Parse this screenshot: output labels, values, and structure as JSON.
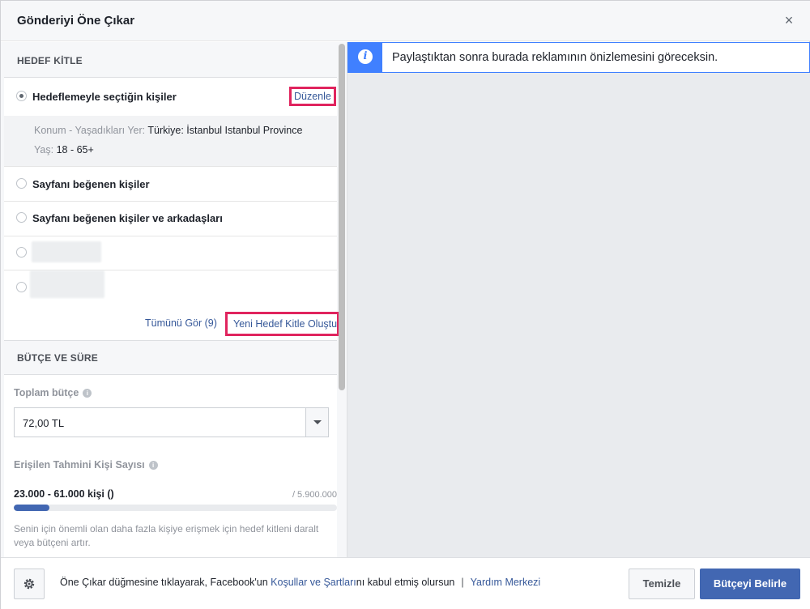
{
  "dialog": {
    "title": "Gönderiyi Öne Çıkar",
    "close_icon": "close-icon"
  },
  "audience": {
    "section_title": "HEDEF KİTLE",
    "options": [
      {
        "label": "Hedeflemeyle seçtiğin kişiler",
        "selected": true
      },
      {
        "label": "Sayfanı beğenen kişiler",
        "selected": false
      },
      {
        "label": "Sayfanı beğenen kişiler ve arkadaşları",
        "selected": false
      },
      {
        "label": "",
        "selected": false
      },
      {
        "label": "",
        "selected": false
      }
    ],
    "edit_label": "Düzenle",
    "details": {
      "location_key": "Konum - Yaşadıkları Yer:",
      "location_value": "Türkiye: İstanbul Istanbul Province",
      "age_key": "Yaş:",
      "age_value": "18 - 65+"
    },
    "see_all_label": "Tümünü Gör (9)",
    "new_audience_label": "Yeni Hedef Kitle Oluştur"
  },
  "budget": {
    "section_title": "BÜTÇE VE SÜRE",
    "total_label": "Toplam bütçe",
    "total_value": "72,00 TL",
    "reach_label": "Erişilen Tahmini Kişi Sayısı",
    "reach_range": "23.000 - 61.000 kişi ()",
    "reach_total": "/ 5.900.000",
    "reach_fraction": 0.11,
    "hint": "Senin için önemli olan daha fazla kişiye erişmek için hedef kitleni daralt veya bütçeni artır."
  },
  "preview": {
    "notice": "Paylaştıktan sonra burada reklamının önizlemesini göreceksin.",
    "icon": "info-icon"
  },
  "footer": {
    "text_before": "Öne Çıkar düğmesine tıklayarak, Facebook'un ",
    "terms_link": "Koşullar ve Şartları",
    "text_after": "nı kabul etmiş olursun",
    "separator": "|",
    "help_link": "Yardım Merkezi",
    "clear_label": "Temizle",
    "submit_label": "Bütçeyi Belirle",
    "settings_icon": "gear-icon"
  },
  "colors": {
    "accent": "#4267b2",
    "link": "#365899",
    "highlight": "#e0245e",
    "info": "#4080ff"
  }
}
